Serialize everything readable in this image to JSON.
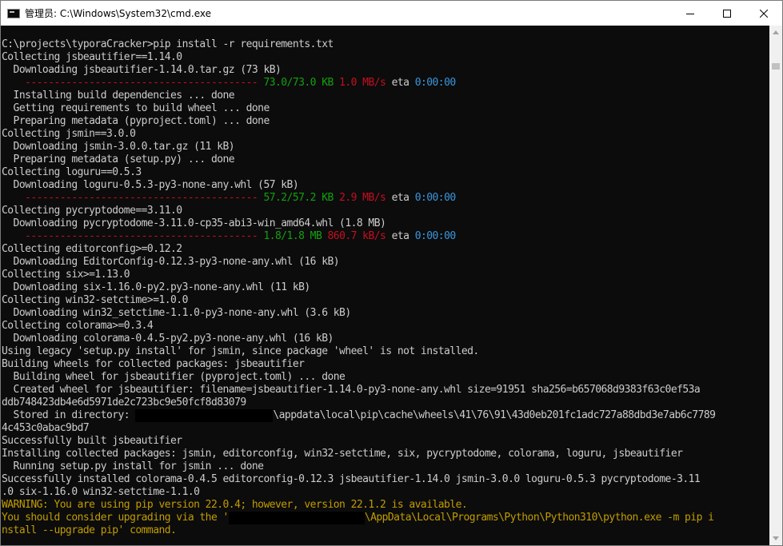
{
  "window": {
    "title": "管理员: C:\\Windows\\System32\\cmd.exe",
    "app_icon": "console-icon",
    "controls": {
      "minimize_icon": "minimize-icon",
      "maximize_icon": "maximize-icon",
      "close_icon": "close-icon"
    }
  },
  "colors": {
    "background": "#0c0c0c",
    "text": "#cccccc",
    "green": "#13a10e",
    "red": "#c50f1f",
    "blue": "#3a96dd",
    "yellow": "#c19c00"
  },
  "console": {
    "lines": [
      "",
      "C:\\projects\\typoraCracker>pip install -r requirements.txt",
      "Collecting jsbeautifier==1.14.0",
      "  Downloading jsbeautifier-1.14.0.tar.gz (73 kB)",
      "",
      "  Installing build dependencies ... done",
      "  Getting requirements to build wheel ... done",
      "  Preparing metadata (pyproject.toml) ... done",
      "Collecting jsmin==3.0.0",
      "  Downloading jsmin-3.0.0.tar.gz (11 kB)",
      "  Preparing metadata (setup.py) ... done",
      "Collecting loguru==0.5.3",
      "  Downloading loguru-0.5.3-py3-none-any.whl (57 kB)",
      "",
      "Collecting pycryptodome==3.11.0",
      "  Downloading pycryptodome-3.11.0-cp35-abi3-win_amd64.whl (1.8 MB)",
      "",
      "Collecting editorconfig>=0.12.2",
      "  Downloading EditorConfig-0.12.3-py3-none-any.whl (16 kB)",
      "Collecting six>=1.13.0",
      "  Downloading six-1.16.0-py2.py3-none-any.whl (11 kB)",
      "Collecting win32-setctime>=1.0.0",
      "  Downloading win32_setctime-1.1.0-py3-none-any.whl (3.6 kB)",
      "Collecting colorama>=0.3.4",
      "  Downloading colorama-0.4.5-py2.py3-none-any.whl (16 kB)",
      "Using legacy 'setup.py install' for jsmin, since package 'wheel' is not installed.",
      "Building wheels for collected packages: jsbeautifier",
      "  Building wheel for jsbeautifier (pyproject.toml) ... done",
      "  Created wheel for jsbeautifier: filename=jsbeautifier-1.14.0-py3-none-any.whl size=91951 sha256=b657068d9383f63c0ef53a",
      "ddb748423db4e6d5971de2c723bc9e50fcf8d83079",
      "",
      "4c453c0abac9bd7",
      "Successfully built jsbeautifier",
      "Installing collected packages: jsmin, editorconfig, win32-setctime, six, pycryptodome, colorama, loguru, jsbeautifier",
      "  Running setup.py install for jsmin ... done",
      "Successfully installed colorama-0.4.5 editorconfig-0.12.3 jsbeautifier-1.14.0 jsmin-3.0.0 loguru-0.5.3 pycryptodome-3.11",
      ".0 six-1.16.0 win32-setctime-1.1.0"
    ],
    "progress": [
      {
        "bar": "    ---------------------------------------- ",
        "amount": "73.0/73.0 KB",
        "speed": "1.0 MB/s",
        "eta_label": "eta",
        "eta": "0:00:00"
      },
      {
        "bar": "    ---------------------------------------- ",
        "amount": "57.2/57.2 KB",
        "speed": "2.9 MB/s",
        "eta_label": "eta",
        "eta": "0:00:00"
      },
      {
        "bar": "    ---------------------------------------- ",
        "amount": "1.8/1.8 MB",
        "speed": "860.7 kB/s",
        "eta_label": "eta",
        "eta": "0:00:00"
      }
    ],
    "stored": {
      "prefix": "  Stored in directory: ",
      "suffix": "\\appdata\\local\\pip\\cache\\wheels\\41\\76\\91\\43d0eb201fc1adc727a88dbd3e7ab6c7789"
    },
    "warning": {
      "line1": "WARNING: You are using pip version 22.0.4; however, version 22.1.2 is available.",
      "line2_prefix": "You should consider upgrading via the '",
      "line2_suffix": "\\AppData\\Local\\Programs\\Python\\Python310\\python.exe -m pip i",
      "line3": "nstall --upgrade pip' command."
    }
  },
  "scrollbar": {
    "up_icon": "scroll-up-arrow-icon",
    "down_icon": "scroll-down-arrow-icon",
    "position_fraction": 0.95
  }
}
